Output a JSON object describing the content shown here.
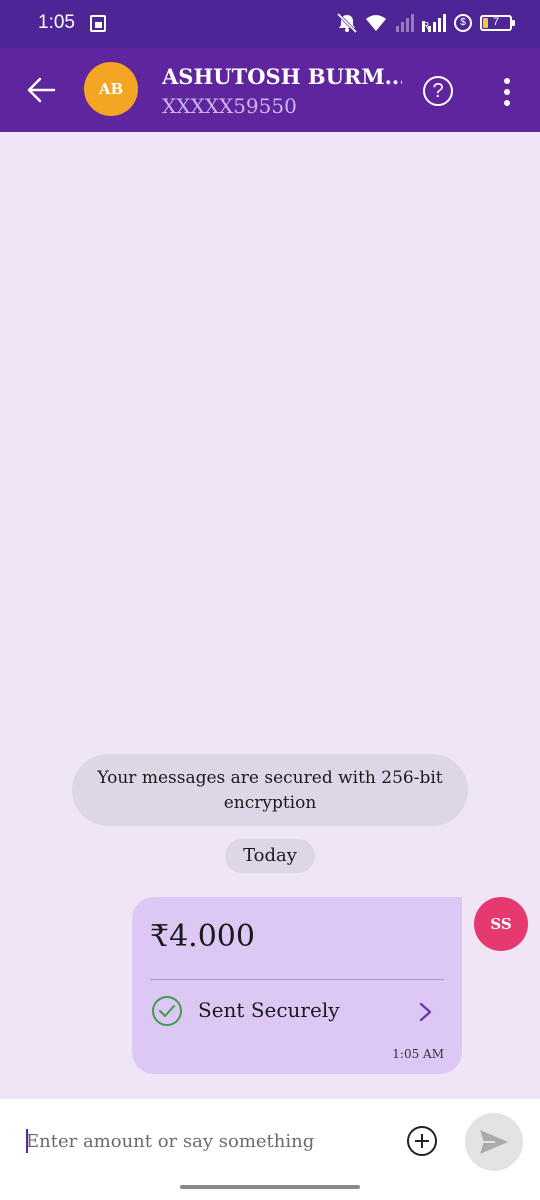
{
  "status_bar": {
    "time": "1:05",
    "battery_level": "7",
    "network_label": "R",
    "icons": [
      "calendar-icon",
      "mute-icon",
      "wifi-icon",
      "signal-icon",
      "vpn-icon",
      "battery-icon"
    ]
  },
  "header": {
    "avatar_initials": "AB",
    "contact_name": "ASHUTOSH BURM...",
    "contact_number": "XXXXX59550",
    "icons": [
      "back-arrow-icon",
      "help-icon",
      "more-options-icon"
    ],
    "colors": {
      "background": "#5f259f",
      "avatar": "#f5a524"
    }
  },
  "chat": {
    "encryption_note": "Your messages are secured with 256-bit encryption",
    "date_label": "Today",
    "payment": {
      "amount": "₹4.000",
      "status": "Sent Securely",
      "time": "1:05 AM",
      "sender_initials": "SS",
      "colors": {
        "card": "#ddc8f5",
        "status_check": "#3e9d4a",
        "sender_avatar": "#e6396f"
      }
    }
  },
  "composer": {
    "placeholder": "Enter amount or say something",
    "value": "",
    "icons": [
      "add-icon",
      "send-icon"
    ]
  }
}
